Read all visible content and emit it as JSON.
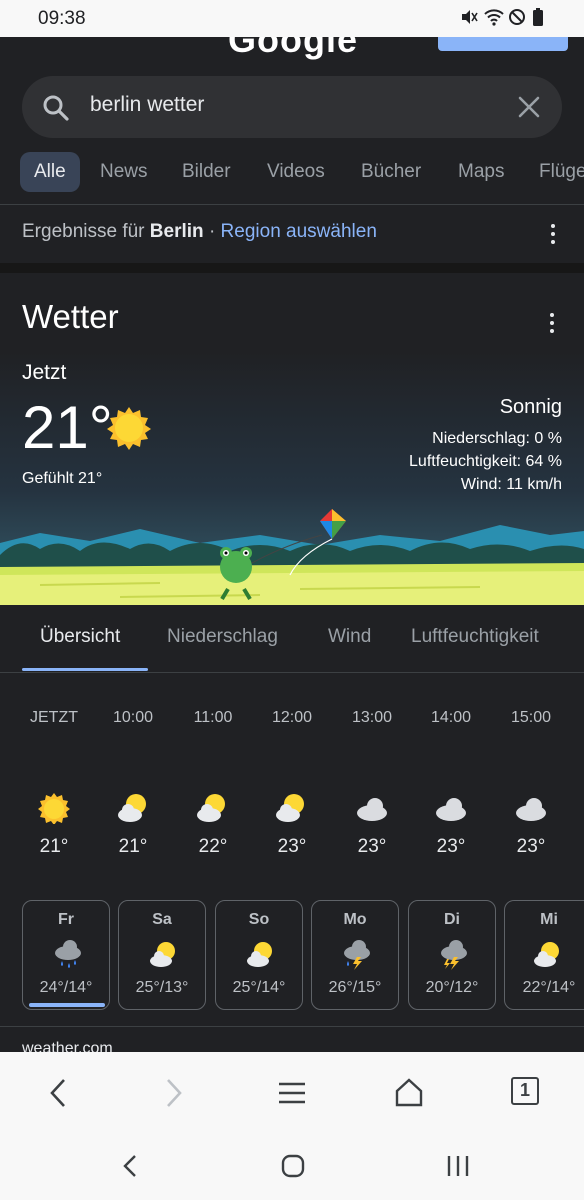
{
  "status_bar": {
    "time": "09:38",
    "icons": [
      "mute-icon",
      "wifi-icon",
      "dnd-icon",
      "battery-icon"
    ]
  },
  "google_header": {
    "logo_text": "Google"
  },
  "search": {
    "query": "berlin wetter"
  },
  "tabs": [
    "Alle",
    "News",
    "Bilder",
    "Videos",
    "Bücher",
    "Maps",
    "Flüge"
  ],
  "region_line": {
    "prefix": "Ergebnisse für",
    "city": "Berlin",
    "separator": "·",
    "link": "Region auswählen"
  },
  "weather": {
    "title": "Wetter",
    "now_label": "Jetzt",
    "temp": "21°",
    "felt": "Gefühlt 21°",
    "condition": "Sonnig",
    "precipitation": "Niederschlag: 0 %",
    "humidity": "Luftfeuchtigkeit: 64 %",
    "wind": "Wind: 11 km/h",
    "subtabs": [
      "Übersicht",
      "Niederschlag",
      "Wind",
      "Luftfeuchtigkeit"
    ],
    "hourly": [
      {
        "time": "JETZT",
        "temp": "21°",
        "icon": "sun-icon"
      },
      {
        "time": "10:00",
        "temp": "21°",
        "icon": "partly-cloudy-icon"
      },
      {
        "time": "11:00",
        "temp": "22°",
        "icon": "partly-cloudy-icon"
      },
      {
        "time": "12:00",
        "temp": "23°",
        "icon": "partly-cloudy-icon"
      },
      {
        "time": "13:00",
        "temp": "23°",
        "icon": "cloud-icon"
      },
      {
        "time": "14:00",
        "temp": "23°",
        "icon": "cloud-icon"
      },
      {
        "time": "15:00",
        "temp": "23°",
        "icon": "cloud-icon"
      }
    ],
    "daily": [
      {
        "day": "Fr",
        "temp": "24°/14°",
        "icon": "rain-cloud-icon"
      },
      {
        "day": "Sa",
        "temp": "25°/13°",
        "icon": "partly-cloudy-icon"
      },
      {
        "day": "So",
        "temp": "25°/14°",
        "icon": "partly-cloudy-icon"
      },
      {
        "day": "Mo",
        "temp": "26°/15°",
        "icon": "thunder-rain-icon"
      },
      {
        "day": "Di",
        "temp": "20°/12°",
        "icon": "thunderstorm-icon"
      },
      {
        "day": "Mi",
        "temp": "22°/14°",
        "icon": "partly-cloudy-icon"
      }
    ],
    "source": "weather.com"
  },
  "browser_bar": {
    "tab_count": "1"
  },
  "colors": {
    "accent": "#8ab4f8",
    "background": "#202124",
    "sun": "#fbc02d"
  }
}
